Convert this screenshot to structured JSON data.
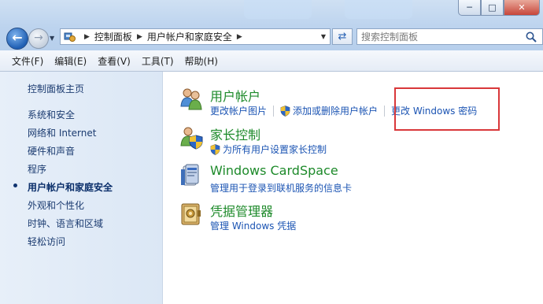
{
  "address": {
    "crumbs": [
      "控制面板",
      "用户帐户和家庭安全"
    ]
  },
  "search": {
    "placeholder": "搜索控制面板"
  },
  "window": {
    "min_glyph": "─",
    "max_glyph": "□",
    "close_glyph": "✕"
  },
  "menus": [
    "文件(F)",
    "编辑(E)",
    "查看(V)",
    "工具(T)",
    "帮助(H)"
  ],
  "sidebar": {
    "home": "控制面板主页",
    "items": [
      "系统和安全",
      "网络和 Internet",
      "硬件和声音",
      "程序",
      "用户帐户和家庭安全",
      "外观和个性化",
      "时钟、语言和区域",
      "轻松访问"
    ],
    "current_index": 4
  },
  "categories": [
    {
      "title": "用户帐户",
      "icon": "users-icon",
      "links": [
        "更改帐户图片",
        "添加或删除用户帐户",
        "更改 Windows 密码"
      ]
    },
    {
      "title": "家长控制",
      "icon": "parental-controls-icon",
      "links": [
        "为所有用户设置家长控制"
      ]
    },
    {
      "title": "Windows CardSpace",
      "icon": "cardspace-icon",
      "links": [
        "管理用于登录到联机服务的信息卡"
      ]
    },
    {
      "title": "凭据管理器",
      "icon": "credential-manager-icon",
      "links": [
        "管理 Windows 凭据"
      ]
    }
  ],
  "colors": {
    "title_green": "#1d8a2a",
    "link_blue": "#1b54b3",
    "highlight_red": "#d9383a"
  }
}
